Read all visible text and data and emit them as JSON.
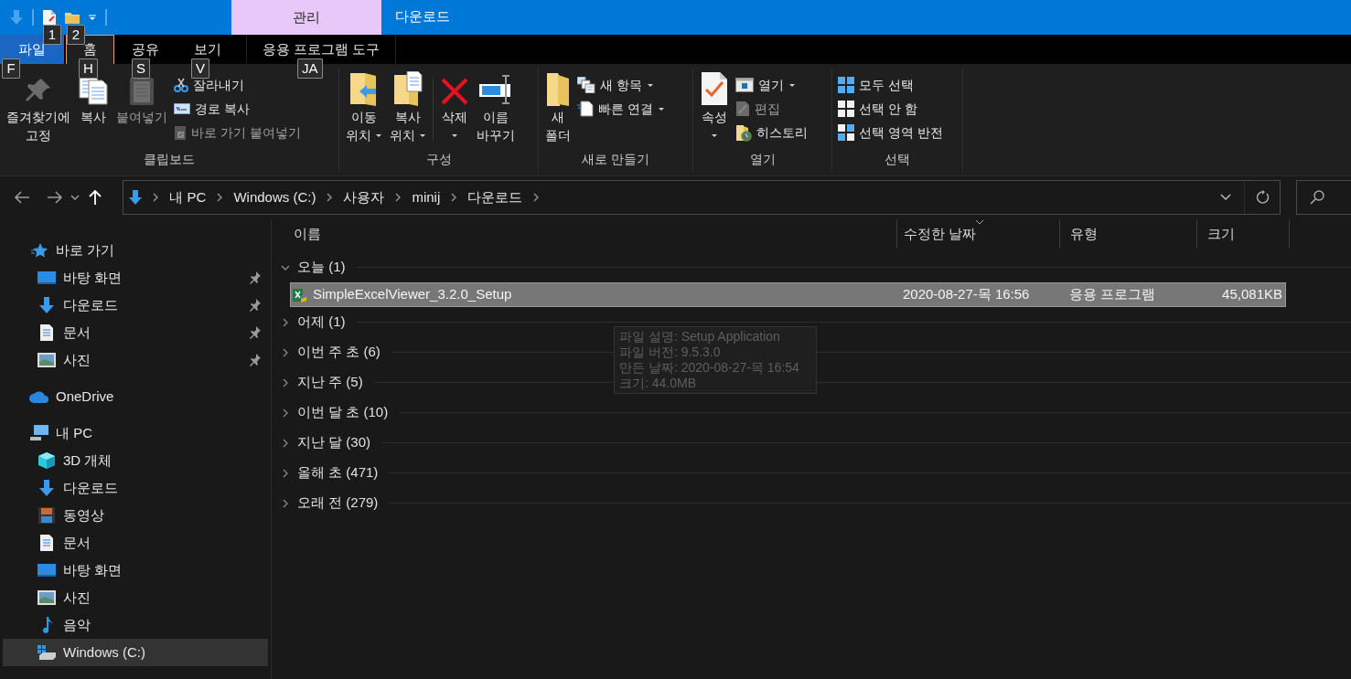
{
  "window": {
    "title": "다운로드"
  },
  "quick_access_toolbar": {
    "keytips": [
      "1",
      "2"
    ]
  },
  "contextual_tab_group": {
    "label": "관리"
  },
  "ribbon_tabs": [
    {
      "label": "파일",
      "kind": "file",
      "selected": false,
      "keytip": "F"
    },
    {
      "label": "홈",
      "kind": "tab",
      "selected": true,
      "keytip": "H"
    },
    {
      "label": "공유",
      "kind": "tab",
      "selected": false,
      "keytip": "S"
    },
    {
      "label": "보기",
      "kind": "tab",
      "selected": false,
      "keytip": "V"
    },
    {
      "label": "응용 프로그램 도구",
      "kind": "contextual",
      "selected": false,
      "keytip": "JA"
    }
  ],
  "ribbon_groups": [
    {
      "label": "클립보드",
      "commands": [
        {
          "kind": "large",
          "label": "즐겨찾기에\n고정",
          "disabled": false,
          "dropdown": false
        },
        {
          "kind": "large",
          "label": "복사",
          "disabled": false,
          "dropdown": false
        },
        {
          "kind": "large",
          "label": "붙여넣기",
          "disabled": true,
          "dropdown": false
        },
        {
          "kind": "small",
          "label": "잘라내기",
          "disabled": false,
          "dropdown": false
        },
        {
          "kind": "small",
          "label": "경로 복사",
          "disabled": false,
          "dropdown": false
        },
        {
          "kind": "small",
          "label": "바로 가기 붙여넣기",
          "disabled": true,
          "dropdown": false
        }
      ]
    },
    {
      "label": "구성",
      "commands": [
        {
          "kind": "large",
          "label": "이동\n위치",
          "disabled": false,
          "dropdown": true
        },
        {
          "kind": "large",
          "label": "복사\n위치",
          "disabled": false,
          "dropdown": true
        },
        {
          "kind": "large",
          "label": "삭제",
          "disabled": false,
          "dropdown": true
        },
        {
          "kind": "large",
          "label": "이름\n바꾸기",
          "disabled": false,
          "dropdown": false
        }
      ]
    },
    {
      "label": "새로 만들기",
      "commands": [
        {
          "kind": "large",
          "label": "새\n폴더",
          "disabled": false,
          "dropdown": false
        },
        {
          "kind": "small",
          "label": "새 항목",
          "disabled": false,
          "dropdown": true
        },
        {
          "kind": "small",
          "label": "빠른 연결",
          "disabled": false,
          "dropdown": true
        }
      ]
    },
    {
      "label": "열기",
      "commands": [
        {
          "kind": "large",
          "label": "속성",
          "disabled": false,
          "dropdown": true
        },
        {
          "kind": "small",
          "label": "열기",
          "disabled": false,
          "dropdown": true
        },
        {
          "kind": "small",
          "label": "편집",
          "disabled": true,
          "dropdown": false
        },
        {
          "kind": "small",
          "label": "히스토리",
          "disabled": false,
          "dropdown": false
        }
      ]
    },
    {
      "label": "선택",
      "commands": [
        {
          "kind": "small",
          "label": "모두 선택",
          "disabled": false,
          "dropdown": false
        },
        {
          "kind": "small",
          "label": "선택 안 함",
          "disabled": false,
          "dropdown": false
        },
        {
          "kind": "small",
          "label": "선택 영역 반전",
          "disabled": false,
          "dropdown": false
        }
      ]
    }
  ],
  "address_bar": {
    "breadcrumbs": [
      "내 PC",
      "Windows (C:)",
      "사용자",
      "minij",
      "다운로드"
    ]
  },
  "navigation_pane": [
    {
      "label": "바로 가기",
      "selected": false,
      "pinned": false,
      "children": [
        {
          "label": "바탕 화면",
          "selected": false,
          "pinned": true
        },
        {
          "label": "다운로드",
          "selected": false,
          "pinned": true
        },
        {
          "label": "문서",
          "selected": false,
          "pinned": true
        },
        {
          "label": "사진",
          "selected": false,
          "pinned": true
        }
      ]
    },
    {
      "label": "OneDrive",
      "selected": false,
      "pinned": false
    },
    {
      "label": "내 PC",
      "selected": false,
      "pinned": false,
      "children": [
        {
          "label": "3D 개체",
          "selected": false,
          "pinned": false
        },
        {
          "label": "다운로드",
          "selected": false,
          "pinned": false
        },
        {
          "label": "동영상",
          "selected": false,
          "pinned": false
        },
        {
          "label": "문서",
          "selected": false,
          "pinned": false
        },
        {
          "label": "바탕 화면",
          "selected": false,
          "pinned": false
        },
        {
          "label": "사진",
          "selected": false,
          "pinned": false
        },
        {
          "label": "음악",
          "selected": false,
          "pinned": false
        },
        {
          "label": "Windows (C:)",
          "selected": true,
          "pinned": false
        }
      ]
    }
  ],
  "file_list": {
    "columns": [
      "이름",
      "수정한 날짜",
      "유형",
      "크기"
    ],
    "groups": [
      {
        "label": "오늘 (1)",
        "expanded": true,
        "files": [
          {
            "name": "SimpleExcelViewer_3.2.0_Setup",
            "modified": "2020-08-27-목 16:56",
            "type": "응용 프로그램",
            "size": "45,081KB",
            "selected": true
          }
        ]
      },
      {
        "label": "어제 (1)",
        "expanded": false
      },
      {
        "label": "이번 주 초 (6)",
        "expanded": false
      },
      {
        "label": "지난 주 (5)",
        "expanded": false
      },
      {
        "label": "이번 달 초 (10)",
        "expanded": false
      },
      {
        "label": "지난 달 (30)",
        "expanded": false
      },
      {
        "label": "올해 초 (471)",
        "expanded": false
      },
      {
        "label": "오래 전 (279)",
        "expanded": false
      }
    ]
  },
  "tooltip": {
    "lines": [
      "파일 설명: Setup Application",
      "파일 버전: 9.5.3.0",
      "만든 날짜: 2020-08-27-목 16:54",
      "크기: 44.0MB"
    ]
  }
}
